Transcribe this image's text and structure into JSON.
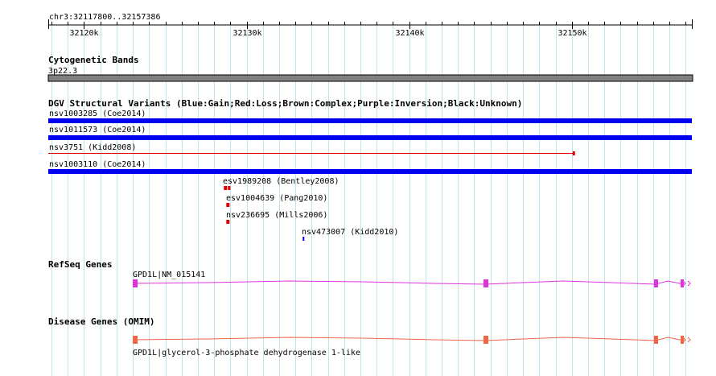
{
  "location": "chr3:32117800..32157386",
  "ruler": {
    "start": 32117800,
    "end": 32157386,
    "minor_step": 1000,
    "labels": [
      {
        "pos": 32120000,
        "text": "32120k"
      },
      {
        "pos": 32130000,
        "text": "32130k"
      },
      {
        "pos": 32140000,
        "text": "32140k"
      },
      {
        "pos": 32150000,
        "text": "32150k"
      }
    ]
  },
  "tracks": {
    "cytoband": {
      "title": "Cytogenetic Bands",
      "band_label": "3p22.3",
      "color": "#808080"
    },
    "dgv": {
      "title": "DGV Structural Variants (Blue:Gain;Red:Loss;Brown:Complex;Purple:Inversion;Black:Unknown)",
      "colors": {
        "gain": "#0000ee",
        "loss": "#dd0000"
      },
      "features": [
        {
          "label": "nsv1003285 (Coe2014)",
          "start": 32117800,
          "end": 32157386,
          "type": "gain"
        },
        {
          "label": "nsv1011573 (Coe2014)",
          "start": 32117800,
          "end": 32157386,
          "type": "gain"
        },
        {
          "label": "nsv3751 (Kidd2008)",
          "start": 32117800,
          "end": 32150100,
          "type": "loss"
        },
        {
          "label": "nsv1003110 (Coe2014)",
          "start": 32117800,
          "end": 32157386,
          "type": "gain"
        },
        {
          "label": "esv1989208 (Bentley2008)",
          "start": 32128600,
          "end": 32129000,
          "type": "loss"
        },
        {
          "label": "esv1004639 (Pang2010)",
          "start": 32128750,
          "end": 32128950,
          "type": "loss"
        },
        {
          "label": "nsv236695 (Mills2006)",
          "start": 32128750,
          "end": 32128950,
          "type": "loss"
        },
        {
          "label": "nsv473007 (Kidd2010)",
          "start": 32133450,
          "end": 32133520,
          "type": "gain"
        }
      ]
    },
    "refseq": {
      "title": "RefSeq Genes",
      "gene_label": "GPD1L|NM_015141",
      "color": "#dd33dd"
    },
    "disease": {
      "title": "Disease Genes (OMIM)",
      "gene_label": "GPD1L|glycerol-3-phosphate dehydrogenase 1-like",
      "color": "#ee6644"
    }
  }
}
